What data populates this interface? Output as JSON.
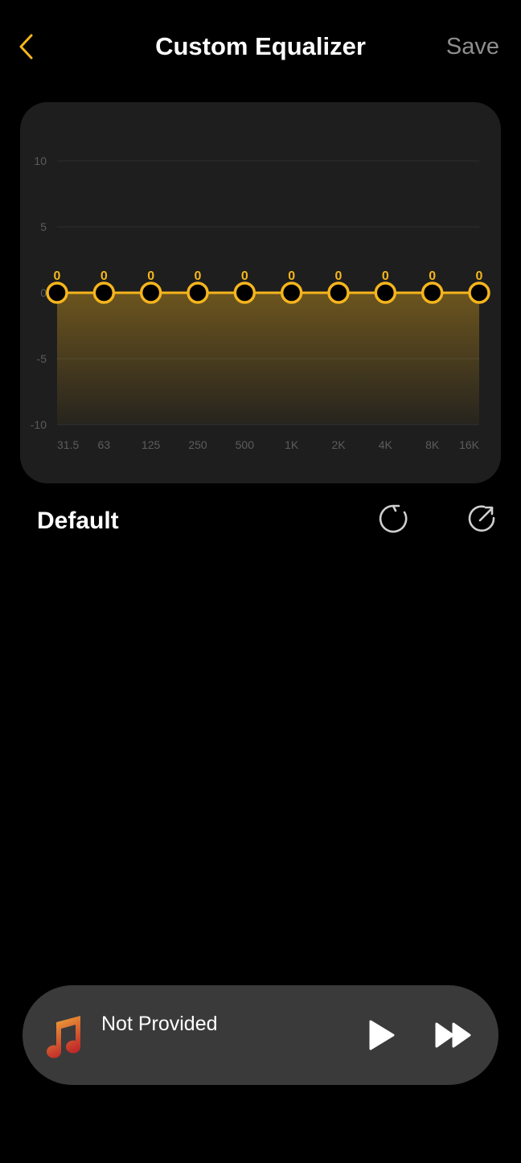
{
  "header": {
    "title": "Custom Equalizer",
    "save_label": "Save"
  },
  "colors": {
    "accent": "#f5b51d",
    "card_bg": "#1e1e1e",
    "player_bg": "#3a3a3a",
    "muted_text": "#8e8e8e"
  },
  "equalizer": {
    "y_ticks": [
      "10",
      "5",
      "0",
      "-5",
      "-10"
    ],
    "bands": [
      "31.5",
      "63",
      "125",
      "250",
      "500",
      "1K",
      "2K",
      "4K",
      "8K",
      "16K"
    ],
    "gains": [
      0,
      0,
      0,
      0,
      0,
      0,
      0,
      0,
      0,
      0
    ],
    "value_labels": [
      "0",
      "0",
      "0",
      "0",
      "0",
      "0",
      "0",
      "0",
      "0",
      "0"
    ],
    "range": [
      -10,
      10
    ]
  },
  "preset": {
    "name": "Default",
    "reset_icon": "reset-icon",
    "share_icon": "share-icon"
  },
  "player": {
    "track_title": "Not Provided",
    "play_icon": "play-icon",
    "next_icon": "fast-forward-icon",
    "art_icon": "music-note-icon"
  }
}
